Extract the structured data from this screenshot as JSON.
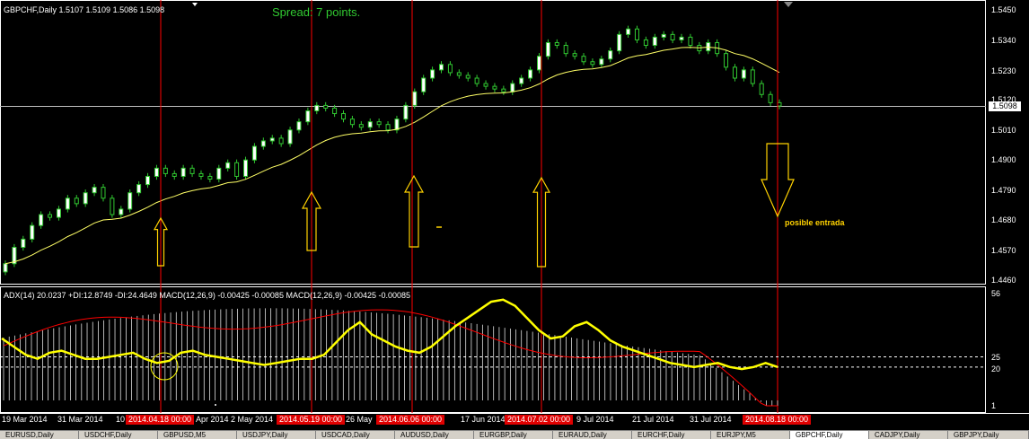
{
  "main_chart": {
    "header": "GBPCHF,Daily  1.5107 1.5109 1.5086 1.5098",
    "spread": "Spread: 7 points.",
    "annotation": "posible entrada",
    "current_price": "1.5098",
    "y_labels": [
      "1.5450",
      "1.5340",
      "1.5230",
      "1.5120",
      "1.5010",
      "1.4900",
      "1.4790",
      "1.4680",
      "1.4570",
      "1.4460"
    ],
    "colors": {
      "bull": "#ffffff",
      "bear": "#ffffff",
      "candle_outline": "#31c931",
      "ma": "#ffff66",
      "vline": "#ff0000",
      "arrow": "#ffd200"
    }
  },
  "indicator": {
    "header": "ADX(14) 20.0237 +DI:12.8749 -DI:24.4649  MACD(12,26,9) -0.00425 -0.00085  MACD(12,26,9) -0.00425 -0.00085",
    "y_labels": [
      "56",
      "25",
      "20",
      "1"
    ],
    "colors": {
      "adx": "#ffff00",
      "signal": "#ff0000",
      "histogram": "#ffffff",
      "levels": "#ffffff"
    }
  },
  "time_axis": {
    "labels": [
      "19 Mar 2014",
      "31 Mar 2014",
      "10",
      "Apr 2014",
      "2 May 2014",
      "26 May",
      "17 Jun 2014",
      "9 Jul 2014",
      "21 Jul 2014",
      "31 Jul 2014"
    ],
    "highlighted": [
      "2014.04.18 00:00",
      "2014.05.19 00:00",
      "2014.06.06 00:00",
      "2014.07.02 00:00",
      "2014.08.18 00:00"
    ]
  },
  "tabs": [
    "EURUSD,Daily",
    "USDCHF,Daily",
    "GBPUSD,M5",
    "USDJPY,Daily",
    "USDCAD,Daily",
    "AUDUSD,Daily",
    "EURGBP,Daily",
    "EURAUD,Daily",
    "EURCHF,Daily",
    "EURJPY,M5",
    "GBPCHF,Daily",
    "CADJPY,Daily",
    "GBPJPY,Daily"
  ],
  "active_tab": "GBPCHF,Daily",
  "chart_data": {
    "type": "line",
    "candles_close": [
      1.452,
      1.458,
      1.461,
      1.466,
      1.47,
      1.469,
      1.472,
      1.476,
      1.474,
      1.478,
      1.48,
      1.476,
      1.47,
      1.472,
      1.478,
      1.481,
      1.484,
      1.487,
      1.485,
      1.484,
      1.487,
      1.485,
      1.484,
      1.483,
      1.487,
      1.489,
      1.484,
      1.49,
      1.495,
      1.497,
      1.498,
      1.496,
      1.501,
      1.504,
      1.508,
      1.51,
      1.509,
      1.507,
      1.505,
      1.503,
      1.502,
      1.504,
      1.503,
      1.501,
      1.505,
      1.51,
      1.515,
      1.52,
      1.523,
      1.525,
      1.522,
      1.521,
      1.52,
      1.518,
      1.517,
      1.516,
      1.515,
      1.518,
      1.52,
      1.523,
      1.528,
      1.533,
      1.532,
      1.529,
      1.528,
      1.526,
      1.525,
      1.527,
      1.53,
      1.536,
      1.538,
      1.534,
      1.532,
      1.535,
      1.536,
      1.534,
      1.535,
      1.532,
      1.53,
      1.533,
      1.529,
      1.524,
      1.52,
      1.523,
      1.518,
      1.514,
      1.511,
      1.5098
    ],
    "adx": [
      34,
      30,
      26,
      24,
      27,
      28,
      26,
      24,
      24,
      25,
      26,
      27,
      24,
      22,
      23,
      27,
      28,
      26,
      25,
      24,
      23,
      22,
      21,
      22,
      23,
      24,
      24,
      26,
      32,
      38,
      42,
      36,
      33,
      30,
      28,
      27,
      30,
      35,
      40,
      44,
      48,
      52,
      53,
      50,
      44,
      38,
      34,
      35,
      40,
      42,
      38,
      33,
      30,
      28,
      26,
      24,
      22,
      21,
      20,
      21,
      22,
      20,
      19,
      20,
      22,
      20
    ],
    "ylim": [
      1.446,
      1.545
    ]
  }
}
